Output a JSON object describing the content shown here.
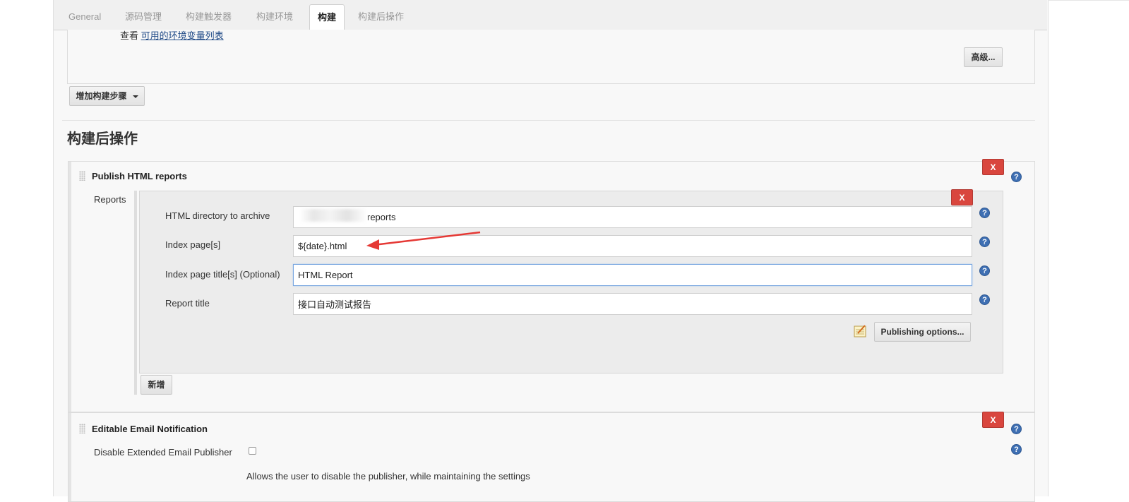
{
  "tabs": [
    "General",
    "源码管理",
    "构建触发器",
    "构建环境",
    "构建",
    "构建后操作"
  ],
  "active_tab": "构建",
  "build": {
    "env_prefix": "查看",
    "env_link": "可用的环境变量列表",
    "advanced_button": "高级...",
    "add_step_button": "增加构建步骤"
  },
  "post_build": {
    "section_title": "构建后操作",
    "html_publisher": {
      "title": "Publish HTML reports",
      "delete_label": "X",
      "reports_label": "Reports",
      "fields": {
        "dir_label": "HTML directory to archive",
        "dir_value": "reports",
        "index_label": "Index page[s]",
        "index_value": "${date}.html",
        "index_title_label": "Index page title[s] (Optional)",
        "index_title_value": "HTML Report",
        "report_title_label": "Report title",
        "report_title_value": "接口自动测试报告"
      },
      "publishing_options_button": "Publishing options...",
      "add_button": "新增"
    },
    "email": {
      "title": "Editable Email Notification",
      "delete_label": "X",
      "disable_label": "Disable Extended Email Publisher",
      "disable_checked": false,
      "disable_description": "Allows the user to disable the publisher, while maintaining the settings"
    }
  },
  "help_label": "?",
  "colors": {
    "delete_red": "#d9463e",
    "help_blue": "#3e6fb3",
    "annotation_arrow": "#e53935"
  }
}
